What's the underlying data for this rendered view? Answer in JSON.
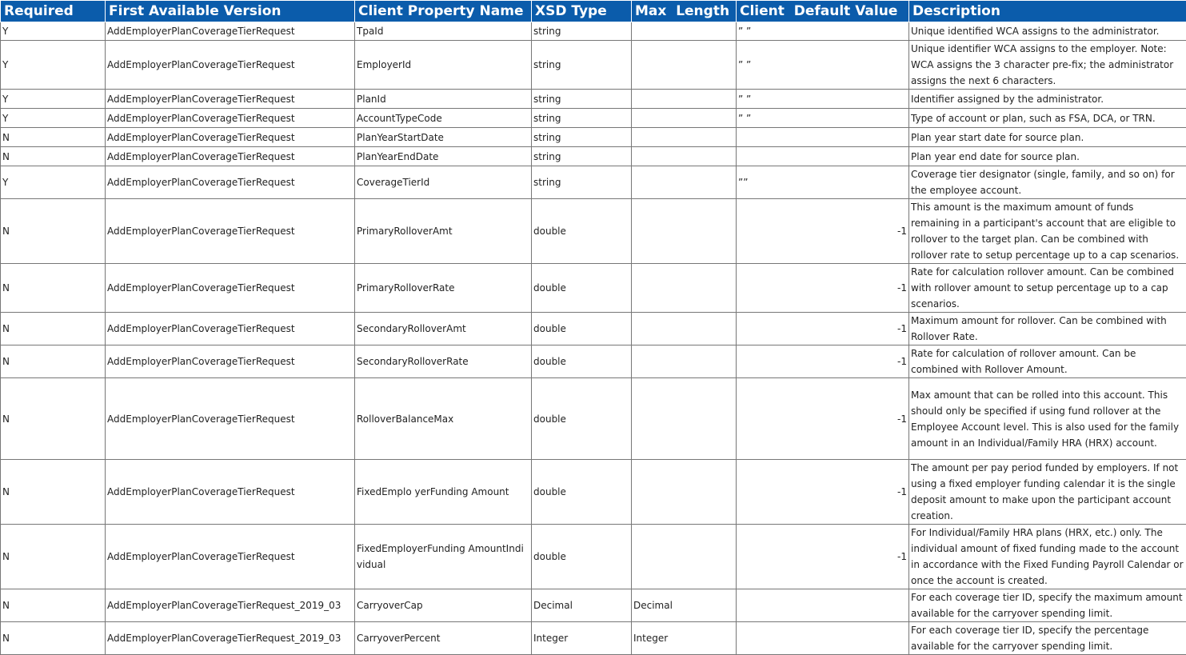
{
  "columns": [
    "Required",
    "First Available Version",
    "Client Property Name",
    "XSD Type",
    "Max  Length",
    "Client  Default Value",
    "Description"
  ],
  "rows": [
    {
      "required": "Y",
      "version": "AddEmployerPlanCoverageTierRequest",
      "property": "TpaId",
      "xsd": "string",
      "max": "",
      "default": "” ”",
      "description": "Unique identified WCA assigns to the administrator."
    },
    {
      "required": "Y",
      "version": "AddEmployerPlanCoverageTierRequest",
      "property": "EmployerId",
      "xsd": "string",
      "max": "",
      "default": "” ”",
      "description": "Unique identifier WCA assigns to the employer. Note: WCA assigns the 3 character pre-fix; the administrator assigns the next 6 characters."
    },
    {
      "required": "Y",
      "version": "AddEmployerPlanCoverageTierRequest",
      "property": "PlanId",
      "xsd": "string",
      "max": "",
      "default": "” ”",
      "description": "Identifier assigned by the administrator."
    },
    {
      "required": "Y",
      "version": "AddEmployerPlanCoverageTierRequest",
      "property": "AccountTypeCode",
      "xsd": "string",
      "max": "",
      "default": "” ”",
      "description": "Type of account or plan, such as FSA, DCA, or TRN."
    },
    {
      "required": "N",
      "version": "AddEmployerPlanCoverageTierRequest",
      "property": "PlanYearStartDate",
      "xsd": "string",
      "max": "",
      "default": "",
      "description": "Plan year start date for source plan."
    },
    {
      "required": "N",
      "version": "AddEmployerPlanCoverageTierRequest",
      "property": "PlanYearEndDate",
      "xsd": "string",
      "max": "",
      "default": "",
      "description": "Plan year end date for source plan."
    },
    {
      "required": "Y",
      "version": "AddEmployerPlanCoverageTierRequest",
      "property": "CoverageTierId",
      "xsd": "string",
      "max": "",
      "default": "””",
      "description": "Coverage tier designator (single, family, and so on) for the employee account."
    },
    {
      "required": "N",
      "version": "AddEmployerPlanCoverageTierRequest",
      "property": "PrimaryRolloverAmt",
      "xsd": "double",
      "max": "",
      "default": "-1",
      "description": "This amount is the maximum amount of funds remaining in a participant's account that are eligible to rollover to the target plan.  Can be combined with rollover rate to setup percentage up to a cap scenarios."
    },
    {
      "required": "N",
      "version": "AddEmployerPlanCoverageTierRequest",
      "property": "PrimaryRolloverRate",
      "xsd": "double",
      "max": "",
      "default": "-1",
      "description": "Rate for calculation rollover amount. Can be combined with rollover amount to setup percentage up to a cap scenarios."
    },
    {
      "required": "N",
      "version": "AddEmployerPlanCoverageTierRequest",
      "property": "SecondaryRolloverAmt",
      "xsd": "double",
      "max": "",
      "default": "-1",
      "description": "Maximum amount for rollover. Can be combined with Rollover Rate."
    },
    {
      "required": "N",
      "version": "AddEmployerPlanCoverageTierRequest",
      "property": "SecondaryRolloverRate",
      "xsd": "double",
      "max": "",
      "default": "-1",
      "description": "Rate for calculation of rollover amount. Can be combined with Rollover Amount."
    },
    {
      "required": "N",
      "version": "AddEmployerPlanCoverageTierRequest",
      "property": "RolloverBalanceMax",
      "xsd": "double",
      "max": "",
      "default": "-1",
      "description": "Max amount that can be rolled into this account. This should only be specified if using fund rollover at the Employee Account level. This is also used for the family amount in an Individual/Family HRA (HRX) account."
    },
    {
      "required": "N",
      "version": "AddEmployerPlanCoverageTierRequest",
      "property": "FixedEmplo yerFunding Amount",
      "xsd": "double",
      "max": "",
      "default": "-1",
      "description": "The amount per pay period funded by employers. If not using a fixed employer funding calendar it is the single deposit amount to make upon the participant account creation."
    },
    {
      "required": "N",
      "version": "AddEmployerPlanCoverageTierRequest",
      "property": "FixedEmployerFunding AmountIndi vidual",
      "xsd": "double",
      "max": "",
      "default": "-1",
      "description": "For Individual/Family HRA plans (HRX, etc.) only. The individual amount of fixed funding made to the account in accordance with the Fixed Funding Payroll Calendar or once the account is created."
    },
    {
      "required": "N",
      "version": "AddEmployerPlanCoverageTierRequest_2019_03",
      "property": "CarryoverCap",
      "xsd": "Decimal",
      "max": "Decimal",
      "default": "",
      "description": "For each coverage tier ID, specify the maximum amount available for the carryover spending limit."
    },
    {
      "required": "N",
      "version": "AddEmployerPlanCoverageTierRequest_2019_03",
      "property": "CarryoverPercent",
      "xsd": "Integer",
      "max": "Integer",
      "default": "",
      "description": "For each coverage tier ID, specify the percentage available for the carryover spending limit."
    }
  ]
}
